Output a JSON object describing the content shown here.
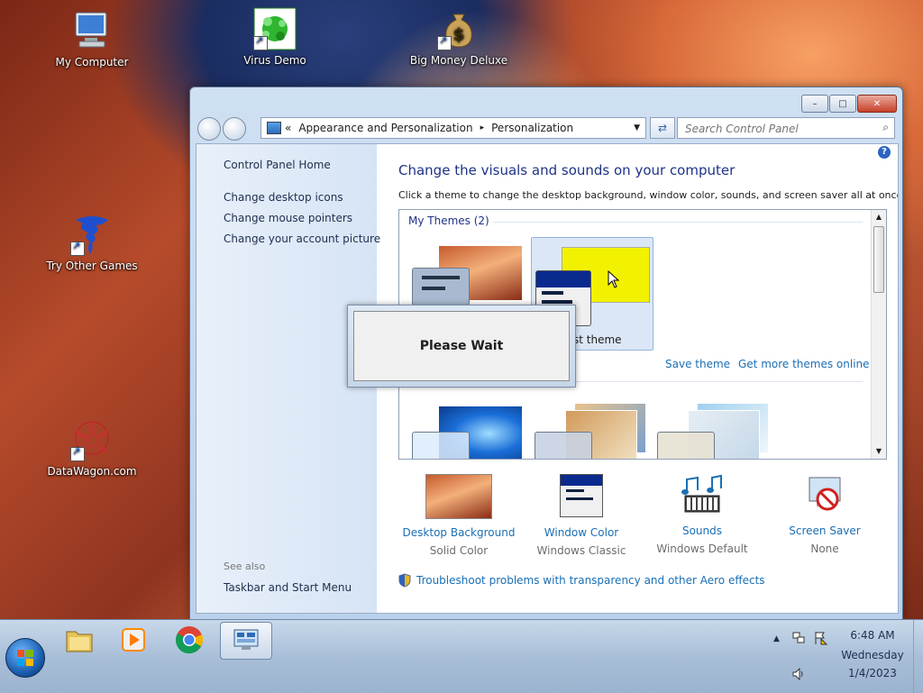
{
  "desktop": {
    "icons": [
      {
        "label": "My Computer",
        "icon": "computer-icon"
      },
      {
        "label": "Virus Demo",
        "icon": "virus-icon"
      },
      {
        "label": "Big Money Deluxe",
        "icon": "money-bag-icon"
      },
      {
        "label": "Try Other Games",
        "icon": "tornado-icon"
      },
      {
        "label": "DataWagon.com",
        "icon": "datawagon-icon"
      }
    ]
  },
  "window": {
    "breadcrumb": {
      "chevron": "«",
      "items": [
        "Appearance and Personalization",
        "Personalization"
      ],
      "separator": "▸"
    },
    "search_placeholder": "Search Control Panel",
    "help_glyph": "?",
    "sidebar": {
      "home": "Control Panel Home",
      "links": [
        "Change desktop icons",
        "Change mouse pointers",
        "Change your account picture"
      ],
      "see_also": "See also",
      "see_also_links": [
        "Taskbar and Start Menu"
      ]
    },
    "main": {
      "title": "Change the visuals and sounds on your computer",
      "subtitle": "Click a theme to change the desktop background, window color, sounds, and screen saver all at once.",
      "my_themes_label": "My Themes (2)",
      "selected_theme_label": "st theme",
      "save_theme": "Save theme",
      "get_more": "Get more themes online",
      "bottom": [
        {
          "title": "Desktop Background",
          "value": "Solid Color",
          "icon": "desktop-background-icon"
        },
        {
          "title": "Window Color",
          "value": "Windows Classic",
          "icon": "window-color-icon"
        },
        {
          "title": "Sounds",
          "value": "Windows Default",
          "icon": "sounds-icon"
        },
        {
          "title": "Screen Saver",
          "value": "None",
          "icon": "screen-saver-icon"
        }
      ],
      "troubleshoot": "Troubleshoot problems with transparency and other Aero effects"
    }
  },
  "dialog": {
    "text": "Please Wait"
  },
  "taskbar": {
    "apps": [
      "file-explorer-icon",
      "media-player-icon",
      "chrome-icon",
      "control-panel-icon"
    ],
    "clock": {
      "time": "6:48 AM",
      "day": "Wednesday",
      "date": "1/4/2023"
    },
    "tray_arrow": "▲"
  },
  "colors": {
    "link": "#1a6fb5",
    "title": "#1e3287",
    "selected_theme": "#f2f200"
  }
}
